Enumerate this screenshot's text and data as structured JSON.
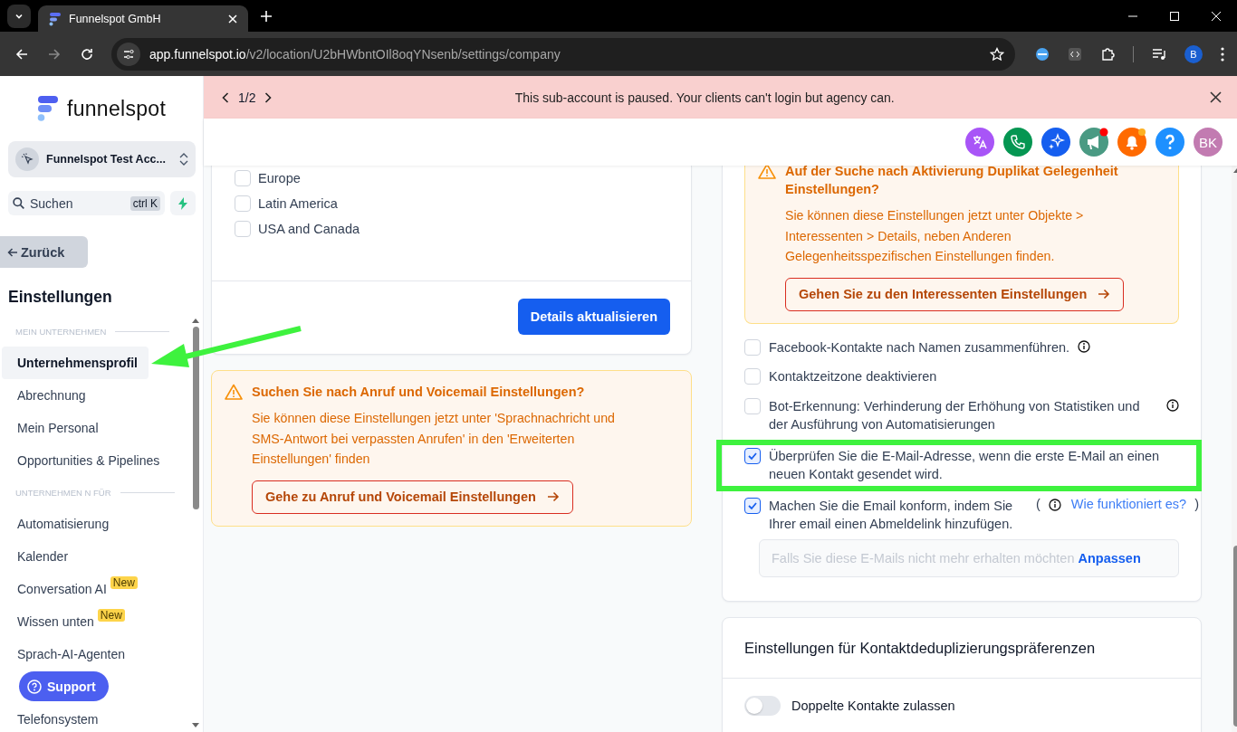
{
  "browser": {
    "tab_title": "Funnelspot GmbH",
    "url_host": "app.funnelspot.io",
    "url_path": "/v2/location/U2bHWbntOIl8oqYNsenb/settings/company",
    "profile_initial": "B"
  },
  "sidebar": {
    "logo": "funnelspot",
    "account": "Funnelspot Test Acc...",
    "search_placeholder": "Suchen",
    "shortcut": "ctrl K",
    "back": "Zurück",
    "heading": "Einstellungen",
    "sections": [
      {
        "label": "MEIN UNTERNEHMEN",
        "items": [
          {
            "label": "Unternehmensprofil",
            "selected": true
          },
          {
            "label": "Abrechnung",
            "selected": false
          },
          {
            "label": "Mein Personal",
            "selected": false
          },
          {
            "label": "Opportunities & Pipelines",
            "selected": false
          }
        ]
      },
      {
        "label": "UNTERNEHMEN  N FÜR",
        "items": [
          {
            "label": "Automatisierung",
            "selected": false
          },
          {
            "label": "Kalender",
            "selected": false
          },
          {
            "label": "Conversation AI",
            "selected": false,
            "badge": "New"
          },
          {
            "label": "Wissen unten",
            "selected": false,
            "badge": "New"
          },
          {
            "label": "Sprach-AI-Agenten",
            "selected": false
          },
          {
            "label": "Telefonsystem",
            "selected": false
          }
        ]
      }
    ],
    "support": "Support"
  },
  "banner": {
    "pager": "1/2",
    "message": "This sub-account is paused. Your clients can't login but agency can."
  },
  "header": {
    "avatar": "BK"
  },
  "left": {
    "regions": [
      {
        "label": "Europe",
        "checked": false
      },
      {
        "label": "Latin America",
        "checked": false
      },
      {
        "label": "USA and Canada",
        "checked": false
      }
    ],
    "update_button": "Details aktualisieren",
    "callout": {
      "title": "Suchen Sie nach Anruf und Voicemail Einstellungen?",
      "body": "Sie können diese Einstellungen jetzt unter 'Sprachnachricht und SMS-Antwort bei verpassten Anrufen' in den 'Erweiterten Einstellungen' finden",
      "button": "Gehe zu Anruf und Voicemail Einstellungen"
    }
  },
  "right": {
    "callout": {
      "title": "Auf der Suche nach Aktivierung Duplikat Gelegenheit Einstellungen?",
      "body": "Sie können diese Einstellungen jetzt unter Objekte > Interessenten > Details, neben Anderen Gelegenheitsspezifischen Einstellungen finden.",
      "button": "Gehen Sie zu den Interessenten Einstellungen"
    },
    "options": [
      {
        "kind": "checkbox",
        "label": "Facebook-Kontakte nach Namen zusammenführen.",
        "checked": false,
        "info": true,
        "highlighted": false
      },
      {
        "kind": "checkbox",
        "label": "Kontaktzeitzone deaktivieren",
        "checked": false,
        "info": false,
        "highlighted": false
      },
      {
        "kind": "checkbox",
        "label": "Bot-Erkennung: Verhinderung der Erhöhung von Statistiken und der Ausführung von Automatisierungen",
        "checked": false,
        "info": true,
        "highlighted": false
      },
      {
        "kind": "checkbox",
        "label": "Überprüfen Sie die E-Mail-Adresse, wenn die erste E-Mail an einen neuen Kontakt gesendet wird.",
        "checked": true,
        "info": false,
        "highlighted": true
      },
      {
        "kind": "compliance",
        "label": "Machen Sie die Email konform, indem Sie Ihrer email einen Abmeldelink hinzufügen.",
        "checked": true,
        "info": true,
        "highlighted": false,
        "open_paren": "(",
        "link": "Wie funktioniert es?",
        "close_paren": ")",
        "footer_text": "Falls Sie diese E-Mails nicht mehr erhalten möchten",
        "footer_link": "Anpassen"
      }
    ],
    "dedupe": {
      "title": "Einstellungen für Kontaktdeduplizierungspräferenzen",
      "toggle": {
        "label": "Doppelte Kontakte zulassen",
        "on": false
      }
    }
  }
}
